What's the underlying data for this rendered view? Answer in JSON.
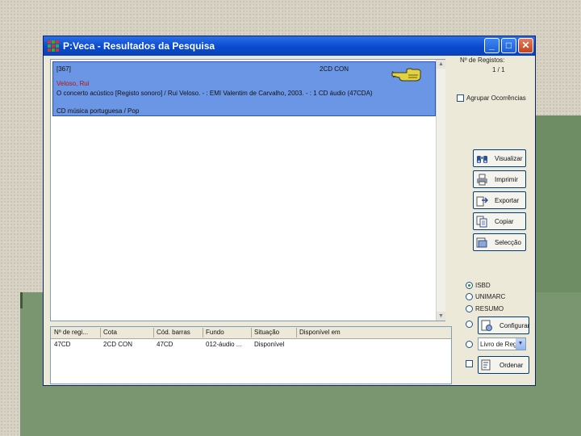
{
  "window": {
    "title": "P:Veca - Resultados da Pesquisa",
    "minimize": "_",
    "maximize": "□",
    "close": "✕"
  },
  "record": {
    "id": "[367]",
    "cota": "2CD CON",
    "author": "Veloso, Rui",
    "description": "O concerto acústico [Registo sonoro] / Rui Veloso. - : EMI Valentim de Carvalho, 2003. - : 1 CD áudio (47CDA)",
    "subject": "CD música portuguesa / Pop"
  },
  "holdings": {
    "columns": [
      "Nº de regi...",
      "Cota",
      "Cód. barras",
      "Fundo",
      "Situação",
      "Disponível em"
    ],
    "rows": [
      [
        "47CD",
        "2CD CON",
        "47CD",
        "012-áudio ...",
        "Disponível",
        ""
      ]
    ]
  },
  "right_panel": {
    "registos_label": "Nº de Registos:",
    "registos_count": "1 / 1",
    "agrupar_label": "Agrupar Ocorrências",
    "buttons": [
      "Visualizar",
      "Imprimir",
      "Exportar",
      "Copiar",
      "Selecção"
    ],
    "formats": [
      {
        "label": "ISBD",
        "selected": true
      },
      {
        "label": "UNIMARC",
        "selected": false
      },
      {
        "label": "RESUMO",
        "selected": false
      }
    ],
    "configurar_label": "Configurar",
    "livro_select": "Livro de Reg",
    "ordenar_label": "Ordenar"
  },
  "status": "",
  "colors": {
    "titlebar": "#0a4ad0",
    "record_bg": "#6b96e6",
    "author_text": "#b4140f",
    "slide_green": "#7a9670"
  }
}
